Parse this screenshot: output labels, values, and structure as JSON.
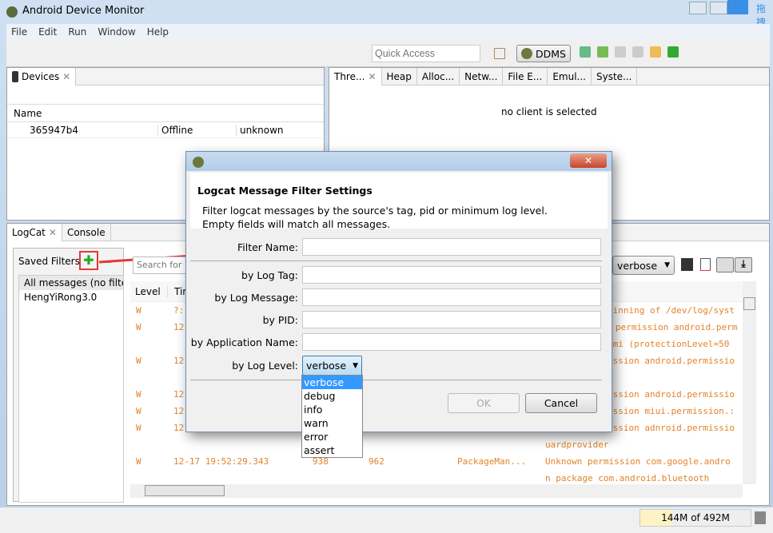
{
  "window": {
    "title": "Android Device Monitor",
    "side_label": "拖拽"
  },
  "menu": [
    "File",
    "Edit",
    "Run",
    "Window",
    "Help"
  ],
  "toolbar": {
    "quick_access": "Quick Access",
    "perspective": "DDMS"
  },
  "devices": {
    "tab": "Devices",
    "column": "Name",
    "rows": [
      {
        "name": "365947b4",
        "state": "Offline",
        "build": "unknown"
      }
    ]
  },
  "right_tabs": [
    "Thre...",
    "Heap",
    "Alloc...",
    "Netw...",
    "File E...",
    "Emul...",
    "Syste..."
  ],
  "right_panel": {
    "message": "no client is selected"
  },
  "logcat": {
    "tab": "LogCat",
    "console_tab": "Console",
    "saved_filters": "Saved Filters",
    "filters": [
      "All messages (no filte",
      "HengYiRong3.0"
    ],
    "search_placeholder": "Search for",
    "level": "verbose",
    "columns": [
      "Level",
      "Tim"
    ],
    "rows": [
      {
        "level": "W",
        "time": "?:",
        "msg": "ginning of /dev/log/syst"
      },
      {
        "level": "W",
        "time": "12",
        "msg": "permission android.perm"
      },
      {
        "level": "",
        "time": "",
        "msg": "omi (protectionLevel=50"
      },
      {
        "level": "W",
        "time": "12",
        "msg": "ission android.permissio"
      },
      {
        "level": "",
        "time": "",
        "msg": ""
      },
      {
        "level": "W",
        "time": "12",
        "msg": "ission android.permissio"
      },
      {
        "level": "W",
        "time": "12",
        "msg": "ission miui.permission.:"
      },
      {
        "level": "W",
        "time": "12",
        "msg": "ission adnroid.permissio"
      },
      {
        "level": "",
        "time": "",
        "msg": "uardprovider"
      },
      {
        "level": "W",
        "time": "12-17 19:52:29.343",
        "pid": "938",
        "tid": "962",
        "tag": "PackageMan...",
        "msg": "Unknown permission com.google.andro"
      },
      {
        "level": "",
        "time": "",
        "msg": "n package com.android.bluetooth"
      }
    ]
  },
  "status": {
    "memory": "144M of 492M"
  },
  "dialog": {
    "heading": "Logcat Message Filter Settings",
    "description1": "Filter logcat messages by the source's tag, pid or minimum log level.",
    "description2": "Empty fields will match all messages.",
    "labels": {
      "name": "Filter Name:",
      "tag": "by Log Tag:",
      "message": "by Log Message:",
      "pid": "by PID:",
      "app": "by Application Name:",
      "level": "by Log Level:"
    },
    "level_value": "verbose",
    "level_options": [
      "verbose",
      "debug",
      "info",
      "warn",
      "error",
      "assert"
    ],
    "ok": "OK",
    "cancel": "Cancel"
  },
  "colors": {
    "log_warn": "#e3832a",
    "highlight": "#e53935",
    "selection": "#3399ff"
  }
}
